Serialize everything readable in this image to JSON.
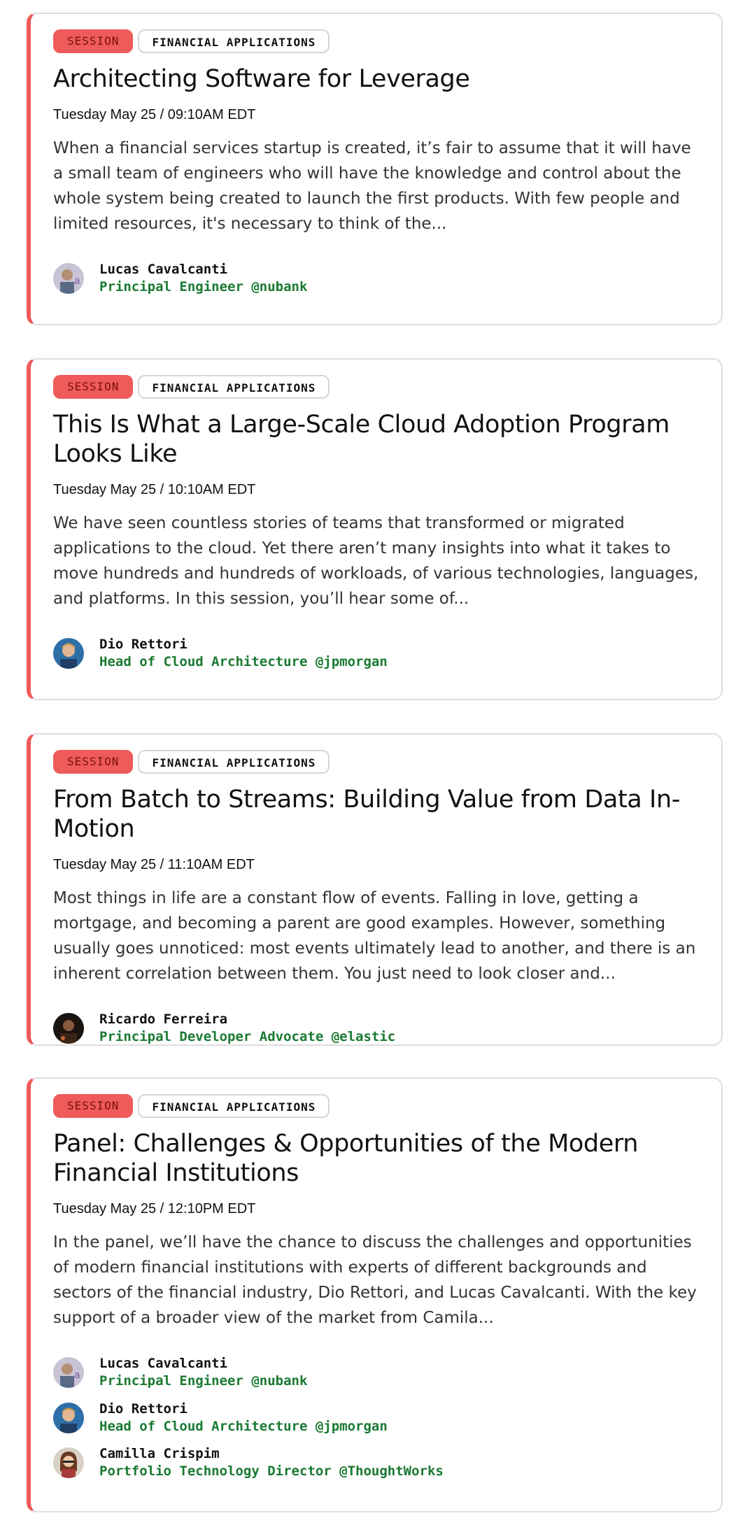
{
  "sessions": [
    {
      "tag": "SESSION",
      "track": "FINANCIAL APPLICATIONS",
      "title": "Architecting Software for Leverage",
      "datetime": "Tuesday May 25 / 09:10AM EDT",
      "description": "When a financial services startup is created, it’s fair to assume that it will have a small team of engineers who will have the knowledge and control about the whole system being created to launch the first products. With few people and limited resources, it's necessary to think of the...",
      "speakers": [
        {
          "name": "Lucas Cavalcanti",
          "role": "Principal Engineer @nubank"
        }
      ]
    },
    {
      "tag": "SESSION",
      "track": "FINANCIAL APPLICATIONS",
      "title": "This Is What a Large-Scale Cloud Adoption Program Looks Like",
      "datetime": "Tuesday May 25 / 10:10AM EDT",
      "description": "We have seen countless stories of teams that transformed or migrated applications to the cloud. Yet there aren’t many insights into what it takes to move hundreds and hundreds of workloads, of various technologies, languages, and platforms.  In this session, you’ll hear some of...",
      "speakers": [
        {
          "name": "Dio Rettori",
          "role": "Head of Cloud Architecture @jpmorgan"
        }
      ]
    },
    {
      "tag": "SESSION",
      "track": "FINANCIAL APPLICATIONS",
      "title": "From Batch to Streams: Building Value from Data In-Motion",
      "datetime": "Tuesday May 25 / 11:10AM EDT",
      "description": "Most things in life are a constant flow of events. Falling in love, getting a mortgage, and becoming a parent are good examples. However, something usually goes unnoticed: most events ultimately lead to another, and there is an inherent correlation between them. You just need to look closer and...",
      "speakers": [
        {
          "name": "Ricardo Ferreira",
          "role": "Principal Developer Advocate @elastic"
        }
      ]
    },
    {
      "tag": "SESSION",
      "track": "FINANCIAL APPLICATIONS",
      "title": "Panel: Challenges & Opportunities of the Modern Financial Institutions",
      "datetime": "Tuesday May 25 / 12:10PM EDT",
      "description": "In the panel, we’ll have the chance to discuss the challenges and opportunities of modern financial institutions with experts of different backgrounds and sectors of the financial industry, Dio Rettori, and Lucas Cavalcanti. With the key support of a broader view of the market from Camila...",
      "speakers": [
        {
          "name": "Lucas Cavalcanti",
          "role": "Principal Engineer @nubank"
        },
        {
          "name": "Dio Rettori",
          "role": "Head of Cloud Architecture @jpmorgan"
        },
        {
          "name": "Camilla Crispim",
          "role": "Portfolio Technology Director @ThoughtWorks"
        }
      ]
    }
  ],
  "colors": {
    "accent": "#ef5a5a",
    "role_green": "#1a7a32",
    "border": "#dedede"
  }
}
